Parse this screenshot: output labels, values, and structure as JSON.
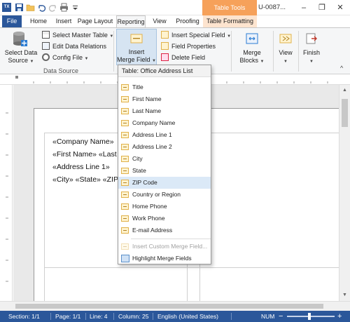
{
  "titlebar": {
    "app_icon": "TX",
    "table_tools": "Table Tools",
    "doc_title": "U-0087...",
    "icons": [
      "app-icon",
      "save-icon",
      "folder-icon",
      "undo-icon",
      "redo-icon",
      "print-icon",
      "qa-dropdown-icon"
    ],
    "window_buttons": [
      "–",
      "❐",
      "✕"
    ]
  },
  "tabs": [
    "File",
    "Home",
    "Insert",
    "Page Layout",
    "Reporting",
    "View",
    "Proofing",
    "Table Formatting"
  ],
  "ribbon": {
    "select_data_source": "Select Data Source",
    "select_data_source_line1": "Select Data",
    "select_data_source_line2": "Source",
    "select_master_table": "Select Master Table",
    "edit_data_relations": "Edit Data Relations",
    "config_file": "Config File",
    "data_source_group": "Data Source",
    "insert_merge_field_line1": "Insert",
    "insert_merge_field_line2": "Merge Field",
    "insert_special_field": "Insert Special Field",
    "field_properties": "Field Properties",
    "delete_field": "Delete Field",
    "merge_blocks_line1": "Merge",
    "merge_blocks_line2": "Blocks",
    "view": "View",
    "finish": "Finish",
    "collapse": "^"
  },
  "document": {
    "lines": [
      "«Company Name»",
      "«First Name» «Last",
      "«Address Line 1»",
      "«City» «State» «ZIP"
    ]
  },
  "dropdown": {
    "header": "Table: Office Address List",
    "items": [
      "Title",
      "First Name",
      "Last Name",
      "Company Name",
      "Address Line 1",
      "Address Line 2",
      "City",
      "State",
      "ZIP Code",
      "Country or Region",
      "Home Phone",
      "Work Phone",
      "E-mail Address"
    ],
    "highlighted_item": "ZIP Code",
    "insert_custom": "Insert Custom Merge Field...",
    "highlight_fields": "Highlight Merge Fields"
  },
  "statusbar": {
    "section": "Section: 1/1",
    "page": "Page: 1/1",
    "line": "Line: 4",
    "column": "Column: 25",
    "language": "English (United States)",
    "num": "NUM",
    "zoom_minus": "−",
    "zoom_plus": "+"
  },
  "colors": {
    "accent": "#2b579a",
    "table_tools": "#f6a15a",
    "highlight": "#dbe9f7"
  }
}
